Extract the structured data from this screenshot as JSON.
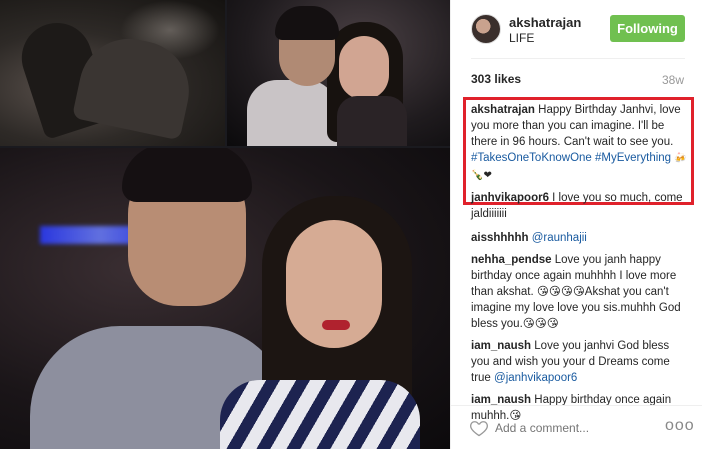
{
  "post": {
    "username": "akshatrajan",
    "location": "LIFE",
    "follow_label": "Following",
    "likes": "303 likes",
    "age": "38w"
  },
  "comments": [
    {
      "user": "akshatrajan",
      "text": "Happy Birthday Janhvi, love you more than you can imagine. I'll be there in 96 hours. Can't wait to see you.",
      "tags": "#TakesOneToKnowOne #MyEverything",
      "emoji": "🍻🍾❤"
    },
    {
      "user": "janhvikapoor6",
      "text": "I love you so much, come jaldiiiiiii"
    },
    {
      "user": "aisshhhhh",
      "tag": "@raunhajii"
    },
    {
      "user": "nehha_pendse",
      "text": "Love you janh happy birthday once again muhhhh I love more than akshat. 😘😘😘😘Akshat you can't imagine my love love you sis.muhhh God bless you.😘😘😘"
    },
    {
      "user": "iam_naush",
      "text": "Love you janhvi God bless you and wish you your d Dreams come true",
      "tag": "@janhvikapoor6"
    },
    {
      "user": "iam_naush",
      "text": "Happy birthday once again muhhh.😘"
    }
  ],
  "footer": {
    "add_comment_placeholder": "Add a comment...",
    "more": "ooo"
  },
  "colors": {
    "follow": "#70c050",
    "highlight": "#e0212b",
    "mention": "#1a5ba0"
  }
}
